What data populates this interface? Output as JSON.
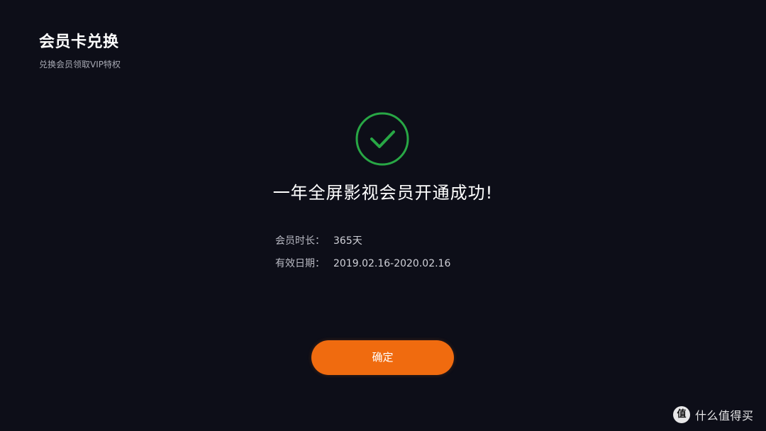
{
  "header": {
    "title": "会员卡兑换",
    "subtitle": "兑换会员领取VIP特权"
  },
  "result": {
    "icon": "check-circle-icon",
    "headline": "一年全屏影视会员开通成功!",
    "accent_color": "#28a745"
  },
  "details": [
    {
      "label": "会员时长：",
      "value": "365天"
    },
    {
      "label": "有效日期：",
      "value": "2019.02.16-2020.02.16"
    }
  ],
  "actions": {
    "confirm_label": "确定",
    "confirm_color": "#f06b0f"
  },
  "watermark": {
    "badge": "值",
    "text": "什么值得买"
  }
}
